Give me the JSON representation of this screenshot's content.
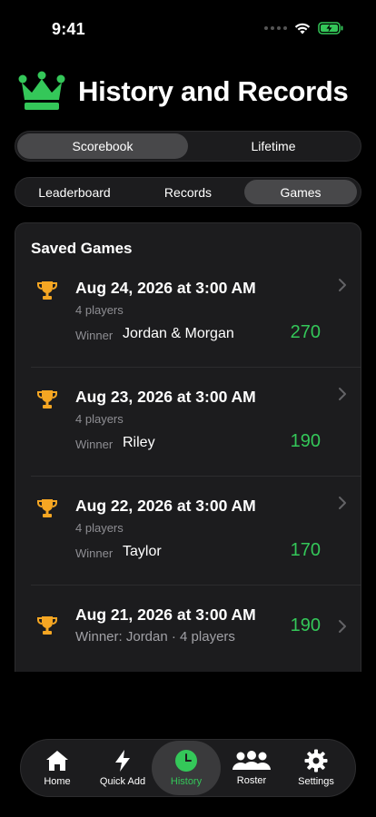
{
  "status_bar": {
    "time": "9:41"
  },
  "header": {
    "title": "History and Records"
  },
  "primary_tabs": [
    {
      "label": "Scorebook",
      "active": true
    },
    {
      "label": "Lifetime",
      "active": false
    }
  ],
  "secondary_tabs": [
    {
      "label": "Leaderboard",
      "active": false
    },
    {
      "label": "Records",
      "active": false
    },
    {
      "label": "Games",
      "active": true
    }
  ],
  "saved_games": {
    "title": "Saved Games",
    "games": [
      {
        "date": "Aug 24, 2026 at 3:00 AM",
        "players": "4 players",
        "winner_label": "Winner",
        "winner": "Jordan & Morgan",
        "score": "270"
      },
      {
        "date": "Aug 23, 2026 at 3:00 AM",
        "players": "4 players",
        "winner_label": "Winner",
        "winner": "Riley",
        "score": "190"
      },
      {
        "date": "Aug 22, 2026 at 3:00 AM",
        "players": "4 players",
        "winner_label": "Winner",
        "winner": "Taylor",
        "score": "170"
      },
      {
        "date": "Aug 21, 2026 at 3:00 AM",
        "summary": "Winner: Jordan · 4 players",
        "score": "190"
      }
    ]
  },
  "tab_bar": {
    "items": [
      {
        "label": "Home",
        "icon": "house-icon"
      },
      {
        "label": "Quick Add",
        "icon": "bolt-icon"
      },
      {
        "label": "History",
        "icon": "clock-icon",
        "active": true
      },
      {
        "label": "Roster",
        "icon": "people-icon"
      },
      {
        "label": "Settings",
        "icon": "gear-icon"
      }
    ]
  },
  "colors": {
    "accent": "#34c759",
    "trophy": "#f5a623",
    "background": "#000000",
    "card": "#1c1c1e"
  }
}
